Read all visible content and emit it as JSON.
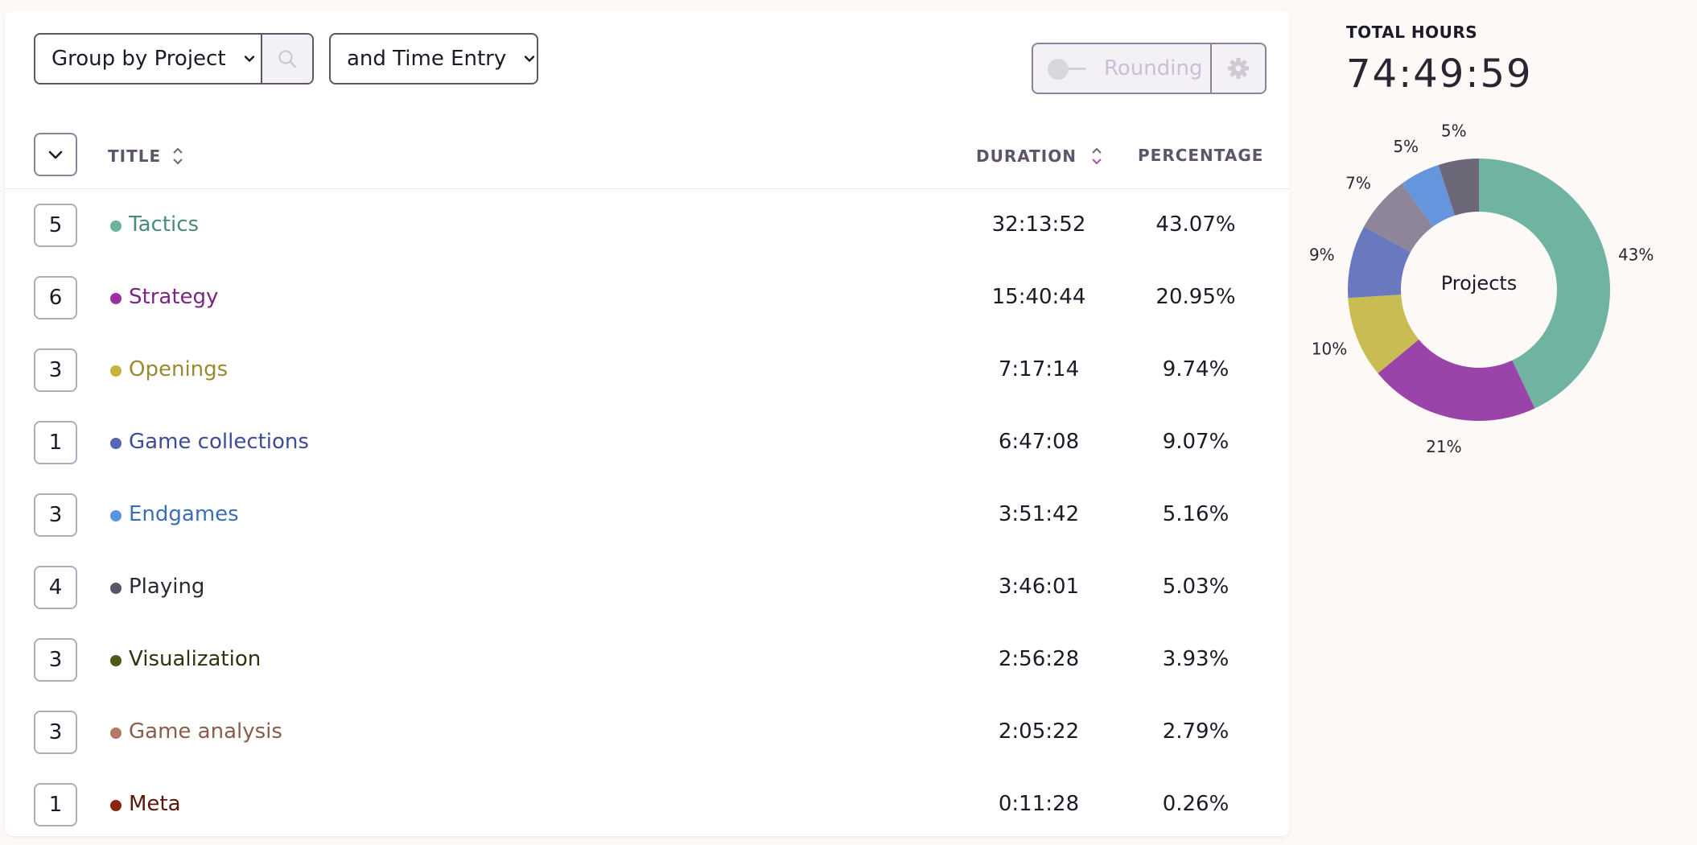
{
  "toolbar": {
    "group_label": "Group by Project",
    "secondary_label": "and Time Entry",
    "rounding_label": "Rounding"
  },
  "table": {
    "headers": {
      "title": "TITLE",
      "duration": "DURATION",
      "percentage": "PERCENTAGE"
    },
    "rows": [
      {
        "count": "5",
        "title": "Tactics",
        "duration": "32:13:52",
        "percentage": "43.07%",
        "color": "#6bb39f",
        "text_color": "#4a8a78"
      },
      {
        "count": "6",
        "title": "Strategy",
        "duration": "15:40:44",
        "percentage": "20.95%",
        "color": "#9b2fa5",
        "text_color": "#7a2782"
      },
      {
        "count": "3",
        "title": "Openings",
        "duration": "7:17:14",
        "percentage": "9.74%",
        "color": "#c8b43c",
        "text_color": "#9a8a30"
      },
      {
        "count": "1",
        "title": "Game collections",
        "duration": "6:47:08",
        "percentage": "9.07%",
        "color": "#5664b8",
        "text_color": "#3e4b98"
      },
      {
        "count": "3",
        "title": "Endgames",
        "duration": "3:51:42",
        "percentage": "5.16%",
        "color": "#5a96de",
        "text_color": "#3a6fb5"
      },
      {
        "count": "4",
        "title": "Playing",
        "duration": "3:46:01",
        "percentage": "5.03%",
        "color": "#565668",
        "text_color": "#2a2a33"
      },
      {
        "count": "3",
        "title": "Visualization",
        "duration": "2:56:28",
        "percentage": "3.93%",
        "color": "#4a5a1c",
        "text_color": "#2c3412"
      },
      {
        "count": "3",
        "title": "Game analysis",
        "duration": "2:05:22",
        "percentage": "2.79%",
        "color": "#b07a63",
        "text_color": "#8a5c4a"
      },
      {
        "count": "1",
        "title": "Meta",
        "duration": "0:11:28",
        "percentage": "0.26%",
        "color": "#8a2410",
        "text_color": "#5a1608"
      }
    ]
  },
  "summary": {
    "title": "TOTAL HOURS",
    "total": "74:49:59"
  },
  "chart_data": {
    "type": "pie",
    "center_label": "Projects",
    "slices": [
      {
        "label": "43%",
        "value": 43,
        "color": "#70b3a1"
      },
      {
        "label": "21%",
        "value": 21,
        "color": "#9a43a8"
      },
      {
        "label": "10%",
        "value": 10,
        "color": "#c9bc52"
      },
      {
        "label": "9%",
        "value": 9,
        "color": "#6a78c0"
      },
      {
        "label": "7%",
        "value": 7,
        "color": "#8f8599"
      },
      {
        "label": "5%",
        "value": 5,
        "color": "#6495dd"
      },
      {
        "label": "5%",
        "value": 5,
        "color": "#6c6878"
      }
    ]
  }
}
